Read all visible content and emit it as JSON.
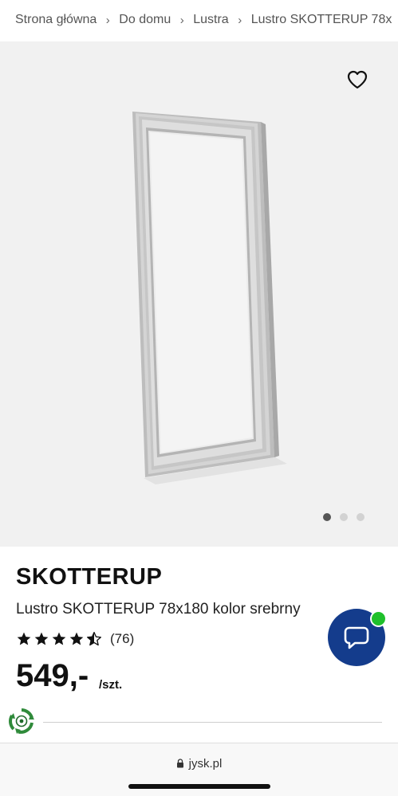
{
  "breadcrumb": {
    "items": [
      "Strona główna",
      "Do domu",
      "Lustra",
      "Lustro SKOTTERUP 78x"
    ],
    "separator": "›"
  },
  "gallery": {
    "favorite_icon": "heart-outline-icon",
    "image_alt": "Lustro SKOTTERUP",
    "dots_total": 3,
    "active_dot": 1
  },
  "product": {
    "brand": "SKOTTERUP",
    "name": "Lustro SKOTTERUP 78x180 kolor srebrny",
    "rating": 4.5,
    "rating_max": 5,
    "rating_count": "(76)",
    "price": "549,-",
    "unit": "/szt."
  },
  "chat": {
    "icon": "chat-bubble-icon",
    "status_color": "#1fc02b",
    "button_color": "#143c8c"
  },
  "browser": {
    "url": "jysk.pl",
    "icon": "lock-icon"
  }
}
